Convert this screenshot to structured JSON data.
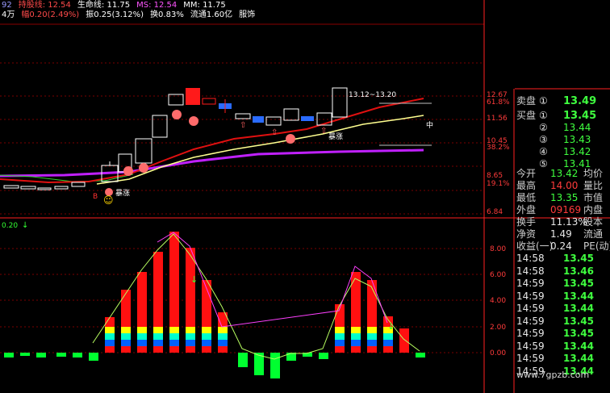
{
  "header": {
    "row1": [
      {
        "text": "92",
        "color": "#9a9aff"
      },
      {
        "text": "持股线: 12.54",
        "color": "#ff4a4a"
      },
      {
        "text": "生命线: 11.75",
        "color": "#ffffff"
      },
      {
        "text": "MS: 12.54",
        "color": "#ff55ff"
      },
      {
        "text": "MM: 11.75",
        "color": "#ffffff"
      }
    ],
    "row2": [
      {
        "text": "4万",
        "color": "#ffffff"
      },
      {
        "text": "幅0.20(2.49%)",
        "color": "#ff4a4a"
      },
      {
        "text": "振0.25(3.12%)",
        "color": "#ffffff"
      },
      {
        "text": "换0.83%",
        "color": "#ffffff"
      },
      {
        "text": "流通1.60亿",
        "color": "#ffffff"
      },
      {
        "text": "服饰",
        "color": "#ffffff"
      }
    ]
  },
  "price_axis": [
    "12.67",
    "61.8%",
    "11.56",
    "10.45",
    "38.2%",
    "8.65",
    "19.1%",
    "6.84"
  ],
  "indicator_axis": [
    "8.00",
    "6.00",
    "4.00",
    "2.00",
    "0.00"
  ],
  "indicator_label": "0.20",
  "annotations": {
    "range_text": "13.12~13.20",
    "baozhang_top": "暴涨",
    "baozhang_bottom": "暴涨",
    "zhong": "中",
    "b_marker": "B"
  },
  "orderbook": {
    "sell_label": "卖盘",
    "buy_label": "买盘",
    "sell_price": "13.49",
    "buy_rows": [
      {
        "n": "①",
        "p": "13.45"
      },
      {
        "n": "②",
        "p": "13.44"
      },
      {
        "n": "③",
        "p": "13.43"
      },
      {
        "n": "④",
        "p": "13.42"
      },
      {
        "n": "⑤",
        "p": "13.41"
      }
    ]
  },
  "stats": [
    {
      "l1": "今开",
      "v1": "13.42",
      "c1": "grn",
      "l2": "均价"
    },
    {
      "l1": "最高",
      "v1": "14.00",
      "c1": "red",
      "l2": "量比"
    },
    {
      "l1": "最低",
      "v1": "13.35",
      "c1": "grn",
      "l2": "市值"
    },
    {
      "l1": "外盘",
      "v1": "09169",
      "c1": "red",
      "l2": "内盘"
    }
  ],
  "stats2": [
    {
      "l1": "换手",
      "v1": "11.13%",
      "c1": "wht",
      "l2": "股本"
    },
    {
      "l1": "净资",
      "v1": "1.49",
      "c1": "wht",
      "l2": "流通"
    },
    {
      "l1": "收益(一)",
      "v1": "0.24",
      "c1": "wht",
      "l2": "PE(动)"
    }
  ],
  "trades": [
    {
      "t": "14:58",
      "p": "13.45"
    },
    {
      "t": "14:58",
      "p": "13.46"
    },
    {
      "t": "14:59",
      "p": "13.45"
    },
    {
      "t": "14:59",
      "p": "13.44"
    },
    {
      "t": "14:59",
      "p": "13.44"
    },
    {
      "t": "14:59",
      "p": "13.45"
    },
    {
      "t": "14:59",
      "p": "13.45"
    },
    {
      "t": "14:59",
      "p": "13.44"
    },
    {
      "t": "14:59",
      "p": "13.44"
    },
    {
      "t": "14:59",
      "p": "13.44"
    }
  ],
  "watermark": "www.7gpzb.com",
  "colors": {
    "up": "#ff2020",
    "down": "#00ffff",
    "grid": "#7a0000",
    "panel": "#ff2b2b",
    "purple": "#c020ff",
    "yellow": "#ffff80",
    "green": "#00ff00"
  }
}
